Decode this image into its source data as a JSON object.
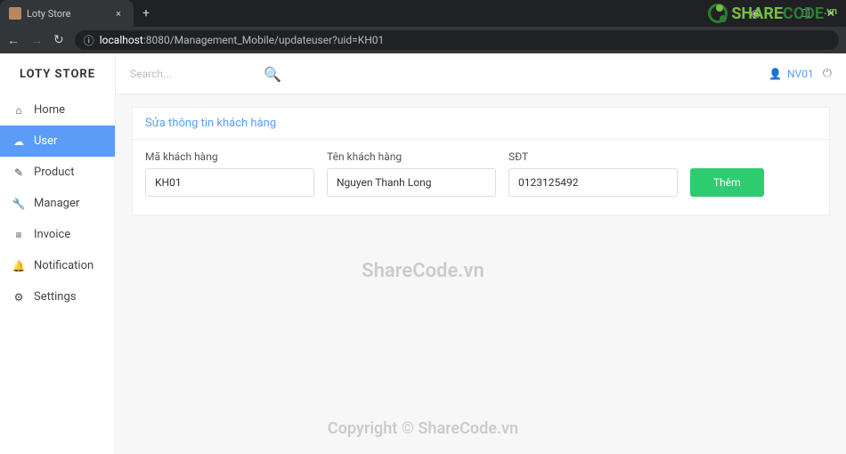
{
  "browser": {
    "tab_title": "Loty Store",
    "url_host": "localhost",
    "url_path": ":8080/Management_Mobile/updateuser?uid=KH01"
  },
  "brand": "LOTY STORE",
  "search": {
    "placeholder": "Search..."
  },
  "user": {
    "name": "NV01"
  },
  "sidebar": {
    "items": [
      {
        "label": "Home"
      },
      {
        "label": "User"
      },
      {
        "label": "Product"
      },
      {
        "label": "Manager"
      },
      {
        "label": "Invoice"
      },
      {
        "label": "Notification"
      },
      {
        "label": "Settings"
      }
    ]
  },
  "panel": {
    "title": "Sửa thông tin khách hàng",
    "fields": {
      "ma_kh": {
        "label": "Mã khách hàng",
        "value": "KH01"
      },
      "ten_kh": {
        "label": "Tên khách hàng",
        "value": "Nguyen Thanh Long"
      },
      "sdt": {
        "label": "SĐT",
        "value": "0123125492"
      }
    },
    "button": "Thêm"
  },
  "watermark": {
    "center": "ShareCode.vn",
    "bottom": "Copyright © ShareCode.vn",
    "logo1": "SHARE",
    "logo2": "CODE",
    "logo3": ".vn"
  }
}
